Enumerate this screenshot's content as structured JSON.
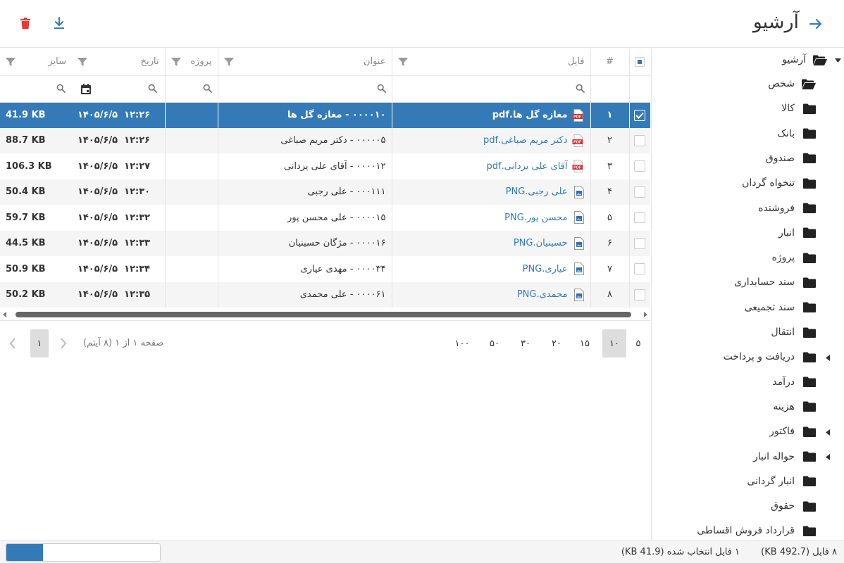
{
  "header": {
    "title": "آرشیو",
    "back_icon": "arrow-right-icon",
    "delete_icon": "trash-icon",
    "download_icon": "download-icon",
    "delete_color": "#e53935",
    "accent_color": "#337ab7"
  },
  "tree": {
    "root": "آرشیو",
    "items": [
      {
        "label": "شخص",
        "open": true
      },
      {
        "label": "کالا"
      },
      {
        "label": "بانک"
      },
      {
        "label": "صندوق"
      },
      {
        "label": "تنخواه گردان"
      },
      {
        "label": "فروشنده"
      },
      {
        "label": "انبار"
      },
      {
        "label": "پروژه"
      },
      {
        "label": "سند حسابداری"
      },
      {
        "label": "سند تجمیعی"
      },
      {
        "label": "انتقال"
      },
      {
        "label": "دریافت و پرداخت",
        "expandable": true
      },
      {
        "label": "درآمد"
      },
      {
        "label": "هزینه"
      },
      {
        "label": "فاکتور",
        "expandable": true
      },
      {
        "label": "حواله انبار",
        "expandable": true
      },
      {
        "label": "انبار گردانی"
      },
      {
        "label": "حقوق"
      },
      {
        "label": "قرارداد فروش اقساطی"
      }
    ]
  },
  "grid": {
    "columns": {
      "num": "#",
      "file": "فایل",
      "title": "عنوان",
      "project": "پروژه",
      "date": "تاریخ",
      "size": "سایز"
    },
    "rows": [
      {
        "num": "۱",
        "file": "مغازه گل ها.pdf",
        "type": "pdf",
        "title": "۰۰۰۰۱۰ - مغازه گل ها",
        "project": "",
        "date": "۱۴۰۵/۶/۵",
        "time": "۱۲:۲۶",
        "size": "41.9 KB",
        "selected": true
      },
      {
        "num": "۲",
        "file": "دکتر مریم صباغی.pdf",
        "type": "pdf",
        "title": "۰۰۰۰۰۵ - دکتر مریم صباغی",
        "project": "",
        "date": "۱۴۰۵/۶/۵",
        "time": "۱۲:۲۶",
        "size": "88.7 KB"
      },
      {
        "num": "۳",
        "file": "آقای علی یزدانی.pdf",
        "type": "pdf",
        "title": "۰۰۰۰۱۲ - آقای علی یزدانی",
        "project": "",
        "date": "۱۴۰۵/۶/۵",
        "time": "۱۲:۲۷",
        "size": "106.3 KB"
      },
      {
        "num": "۴",
        "file": "علی رجبی.PNG",
        "type": "png",
        "title": "۰۰۰۱۱۱ - علی رجبی",
        "project": "",
        "date": "۱۴۰۵/۶/۵",
        "time": "۱۲:۳۰",
        "size": "50.4 KB"
      },
      {
        "num": "۵",
        "file": "محسن پور.PNG",
        "type": "png",
        "title": "۰۰۰۰۱۵ - علی محسن پور",
        "project": "",
        "date": "۱۴۰۵/۶/۵",
        "time": "۱۲:۳۲",
        "size": "59.7 KB"
      },
      {
        "num": "۶",
        "file": "حسینیان.PNG",
        "type": "png",
        "title": "۰۰۰۰۱۶ - مژگان حسینیان",
        "project": "",
        "date": "۱۴۰۵/۶/۵",
        "time": "۱۲:۳۳",
        "size": "44.5 KB"
      },
      {
        "num": "۷",
        "file": "عیاری.PNG",
        "type": "png",
        "title": "۰۰۰۰۳۴ - مهدی عیاری",
        "project": "",
        "date": "۱۴۰۵/۶/۵",
        "time": "۱۲:۳۴",
        "size": "50.9 KB"
      },
      {
        "num": "۸",
        "file": "محمدی.PNG",
        "type": "png",
        "title": "۰۰۰۰۶۱ - علی محمدی",
        "project": "",
        "date": "۱۴۰۵/۶/۵",
        "time": "۱۲:۳۵",
        "size": "50.2 KB"
      }
    ]
  },
  "pager": {
    "sizes": [
      "۵",
      "۱۰",
      "۱۵",
      "۲۰",
      "۳۰",
      "۵۰",
      "۱۰۰"
    ],
    "active_size": "۱۰",
    "info": "صفحه ۱ از ۱ (۸ آیتم)",
    "current_page": "۱"
  },
  "status": {
    "total": "۸ فایل (492.7 KB)",
    "selected": "۱ فایل انتخاب شده (41.9 KB)",
    "progress": 0.24
  }
}
